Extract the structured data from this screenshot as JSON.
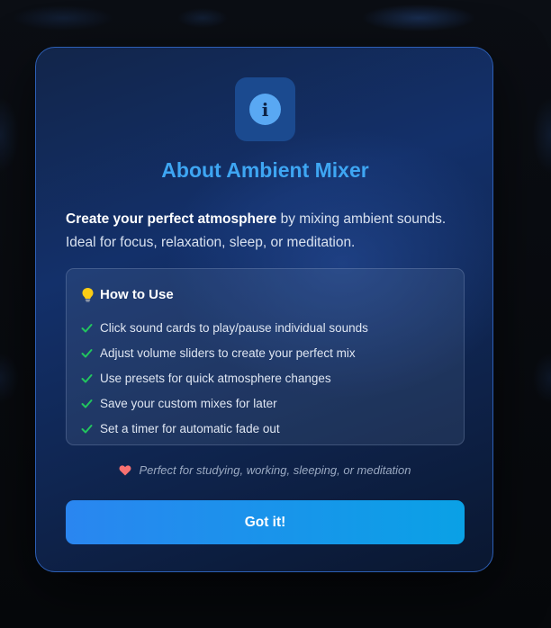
{
  "modal": {
    "icon": "info-icon",
    "title": "About Ambient Mixer",
    "intro_bold": "Create your perfect atmosphere",
    "intro_rest": " by mixing ambient sounds. Ideal for focus, relaxation, sleep, or meditation.",
    "howto": {
      "icon": "lightbulb-icon",
      "title": "How to Use",
      "items": [
        "Click sound cards to play/pause individual sounds",
        "Adjust volume sliders to create your perfect mix",
        "Use presets for quick atmosphere changes",
        "Save your custom mixes for later",
        "Set a timer for automatic fade out"
      ]
    },
    "tagline_icon": "heart-icon",
    "tagline": "Perfect for studying, working, sleeping, or meditation",
    "button_label": "Got it!"
  },
  "colors": {
    "accent": "#3ea6f3",
    "check": "#22c55e",
    "heart": "#f87171",
    "button_start": "#2a86f0",
    "button_end": "#0aa1e6"
  }
}
